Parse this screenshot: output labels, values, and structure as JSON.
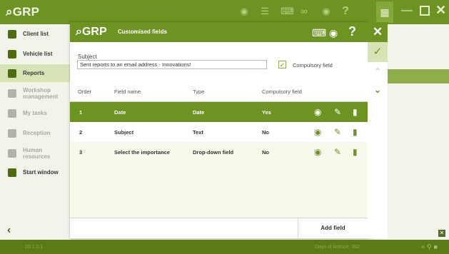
{
  "app": {
    "logo": "⌕GRP",
    "version": "20.1.0.1",
    "days_of_licence": "Days of licence: 362"
  },
  "sidebar": {
    "items": [
      {
        "label": "Client list",
        "enabled": true
      },
      {
        "label": "Vehicle list",
        "enabled": true
      },
      {
        "label": "Reports",
        "enabled": true,
        "active": true
      },
      {
        "label": "Workshop management",
        "enabled": false
      },
      {
        "label": "My tasks",
        "enabled": false
      },
      {
        "label": "Reception",
        "enabled": false
      },
      {
        "label": "Human resources",
        "enabled": false
      },
      {
        "label": "Start window",
        "enabled": true
      }
    ]
  },
  "dialog": {
    "logo": "⌕GRP",
    "title": "Customised fields",
    "subject_label": "Subject",
    "subject_value": "Sent reports to an email address - Innovations!",
    "compulsory_checked": true,
    "compulsory_label": "Compulsory field",
    "columns": [
      "Order",
      "Field name",
      "Type",
      "Compulsory field"
    ],
    "rows": [
      {
        "order": "1",
        "name": "Date",
        "type": "Date",
        "compulsory": "Yes",
        "selected": true
      },
      {
        "order": "2",
        "name": "Subject",
        "type": "Text",
        "compulsory": "No",
        "selected": false
      },
      {
        "order": "3",
        "name": "Select the importance",
        "type": "Drop-down field",
        "compulsory": "No",
        "selected": false
      }
    ],
    "add_field_label": "Add field"
  },
  "colors": {
    "accent": "#6d9322",
    "accent_light": "#d7e3b5",
    "row_alt": "#f8f9ec"
  },
  "icons": {
    "dialog_header": [
      "keyboard-icon",
      "camera-icon",
      "help-icon",
      "close-icon"
    ],
    "row_actions": [
      "eye-icon",
      "pencil-icon",
      "trash-icon"
    ],
    "right_panel": [
      "check-icon",
      "chevron-up-icon",
      "chevron-down-icon"
    ]
  }
}
